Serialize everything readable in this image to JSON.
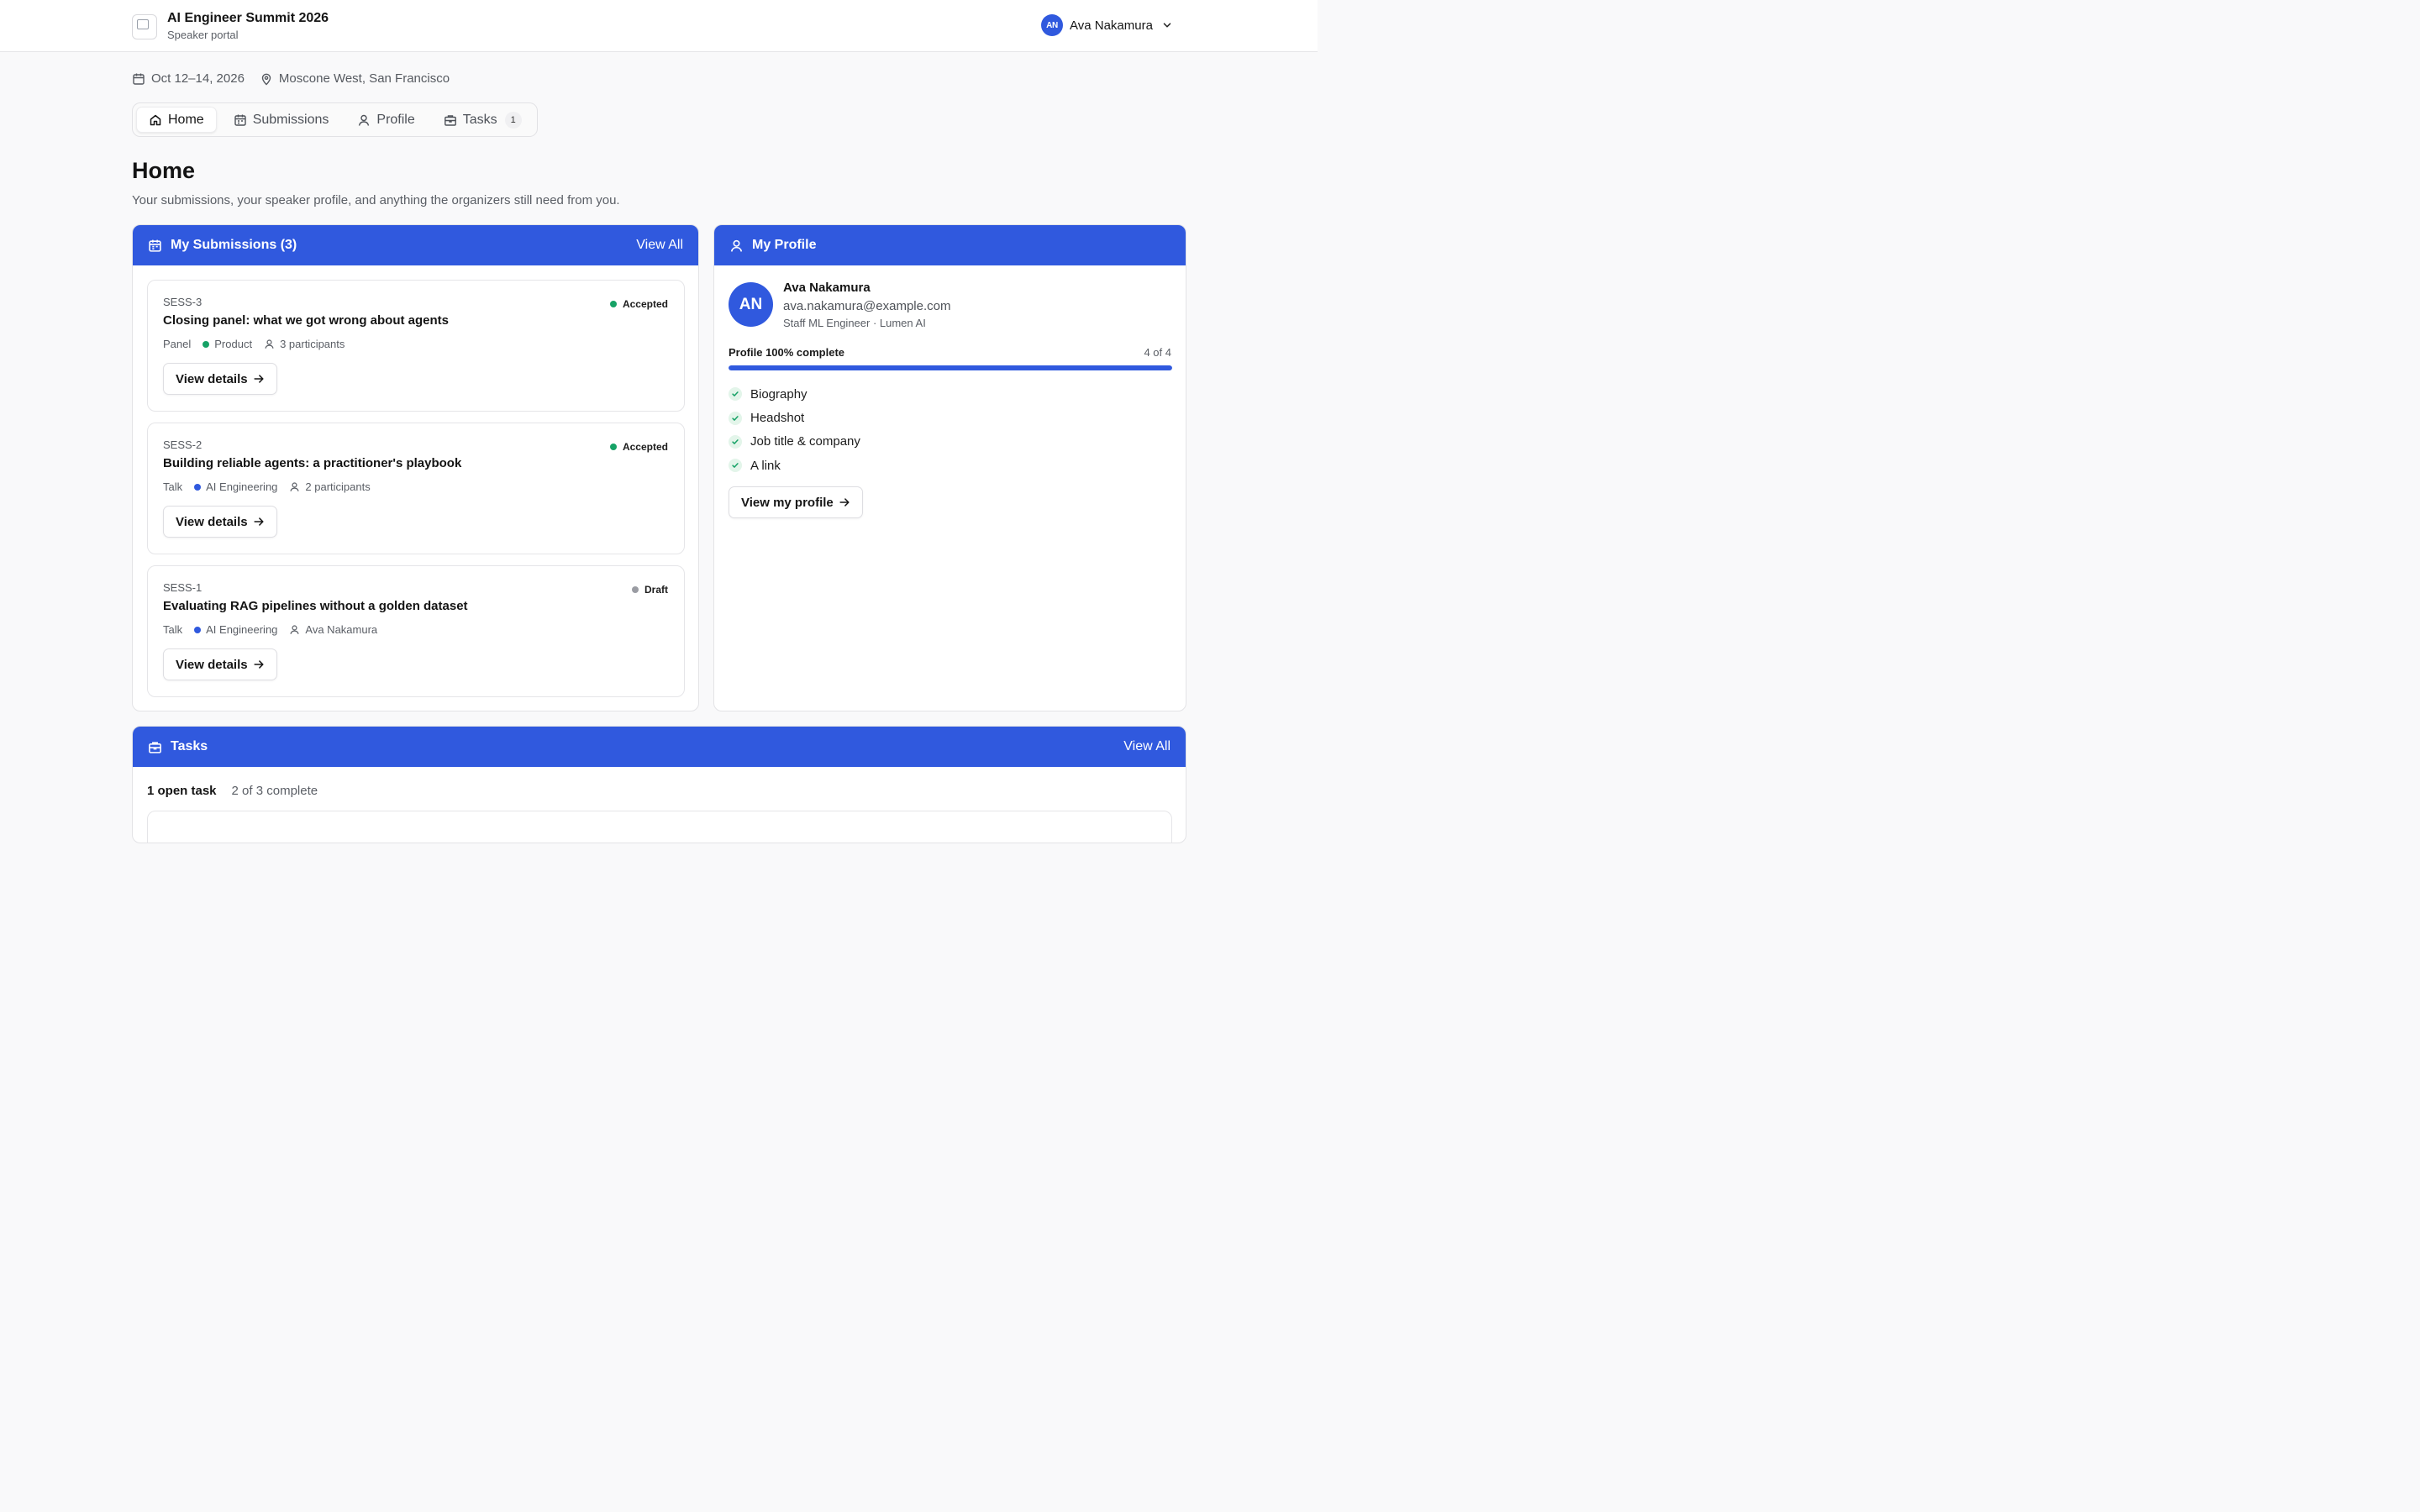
{
  "header": {
    "title": "AI Engineer Summit 2026",
    "subtitle": "Speaker portal",
    "user": {
      "initials": "AN",
      "name": "Ava Nakamura"
    }
  },
  "event": {
    "dates": "Oct 12–14, 2026",
    "location": "Moscone West, San Francisco"
  },
  "tabs": [
    {
      "label": "Home",
      "icon": "home-icon",
      "active": true
    },
    {
      "label": "Submissions",
      "icon": "calendar-icon"
    },
    {
      "label": "Profile",
      "icon": "person-icon"
    },
    {
      "label": "Tasks",
      "icon": "briefcase-icon",
      "badge": "1"
    }
  ],
  "page": {
    "title": "Home",
    "subtitle": "Your submissions, your speaker profile, and anything the organizers still need from you."
  },
  "submissions": {
    "heading": "My Submissions (3)",
    "view_all": "View All",
    "items": [
      {
        "id": "SESS-3",
        "title": "Closing panel: what we got wrong about agents",
        "format": "Panel",
        "track": "Product",
        "track_color": "#16a266",
        "people": "3 participants",
        "status": "Accepted",
        "status_color": "#16a266",
        "button": "View details"
      },
      {
        "id": "SESS-2",
        "title": "Building reliable agents: a practitioner's playbook",
        "format": "Talk",
        "track": "AI Engineering",
        "track_color": "#3059de",
        "people": "2 participants",
        "status": "Accepted",
        "status_color": "#16a266",
        "button": "View details"
      },
      {
        "id": "SESS-1",
        "title": "Evaluating RAG pipelines without a golden dataset",
        "format": "Talk",
        "track": "AI Engineering",
        "track_color": "#3059de",
        "people": "Ava Nakamura",
        "status": "Draft",
        "status_color": "#9a9ca3",
        "button": "View details"
      }
    ]
  },
  "profile": {
    "heading": "My Profile",
    "initials": "AN",
    "name": "Ava Nakamura",
    "email": "ava.nakamura@example.com",
    "role": "Staff ML Engineer · Lumen AI",
    "progress_label": "Profile 100% complete",
    "progress_count": "4 of 4",
    "progress_fraction": 1.0,
    "checklist": [
      "Biography",
      "Headshot",
      "Job title & company",
      "A link"
    ],
    "button": "View my profile"
  },
  "tasks": {
    "heading": "Tasks",
    "view_all": "View All",
    "open": "1 open task",
    "complete": "2 of 3 complete"
  },
  "colors": {
    "accent": "#3059de",
    "success": "#16a266"
  }
}
